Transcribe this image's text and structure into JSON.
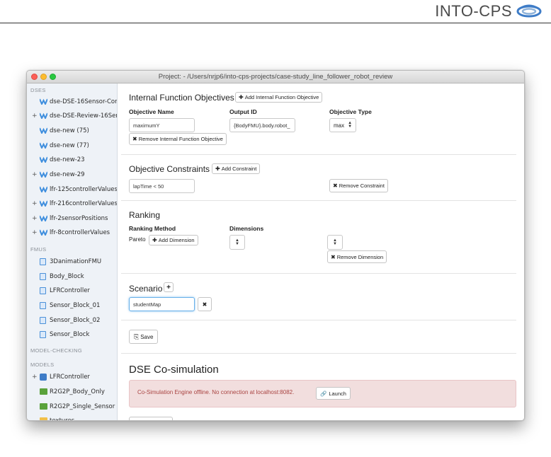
{
  "brand": {
    "name": "INTO-CPS",
    "logo_icon": "into-cps-logo-icon",
    "colors": {
      "primary": "#3e7cc7",
      "accent": "#8fb3da"
    }
  },
  "window": {
    "title": "Project: - /Users/nrjp6/into-cps-projects/case-study_line_follower_robot_review"
  },
  "sidebar": {
    "sections": [
      {
        "header": "DSES",
        "items": [
          {
            "label": "dse-DSE-16Sensor-Conf",
            "expandable": false,
            "icon": "dse-icon"
          },
          {
            "label": "dse-DSE-Review-16Sens",
            "expandable": true,
            "icon": "dse-icon"
          },
          {
            "label": "dse-new (75)",
            "expandable": false,
            "icon": "dse-icon"
          },
          {
            "label": "dse-new (77)",
            "expandable": false,
            "icon": "dse-icon"
          },
          {
            "label": "dse-new-23",
            "expandable": false,
            "icon": "dse-icon"
          },
          {
            "label": "dse-new-29",
            "expandable": true,
            "icon": "dse-icon"
          },
          {
            "label": "lfr-125controllerValues",
            "expandable": false,
            "icon": "dse-icon"
          },
          {
            "label": "lfr-216controllerValues",
            "expandable": true,
            "icon": "dse-icon"
          },
          {
            "label": "lfr-2sensorPositions",
            "expandable": true,
            "icon": "dse-icon"
          },
          {
            "label": "lfr-8controllerValues",
            "expandable": true,
            "icon": "dse-icon"
          }
        ]
      },
      {
        "header": "FMUS",
        "items": [
          {
            "label": "3DanimationFMU",
            "icon": "file-icon"
          },
          {
            "label": "Body_Block",
            "icon": "file-icon"
          },
          {
            "label": "LFRController",
            "icon": "file-icon"
          },
          {
            "label": "Sensor_Block_01",
            "icon": "file-icon"
          },
          {
            "label": "Sensor_Block_02",
            "icon": "file-icon"
          },
          {
            "label": "Sensor_Block",
            "icon": "file-icon"
          }
        ]
      },
      {
        "header": "MODEL-CHECKING",
        "items": []
      },
      {
        "header": "MODELS",
        "items": [
          {
            "label": "LFRController",
            "expandable": true,
            "icon": "fmu-icon"
          },
          {
            "label": "R2G2P_Body_Only",
            "icon": "model-icon"
          },
          {
            "label": "R2G2P_Single_Sensor",
            "icon": "model-icon"
          },
          {
            "label": "textures",
            "icon": "folder-icon"
          }
        ]
      }
    ]
  },
  "internal_objectives": {
    "title": "Internal Function Objectives",
    "add_button": "Add Internal Function Objective",
    "col_name": "Objective Name",
    "col_output": "Output ID",
    "col_type": "Objective Type",
    "name_value": "maximumY",
    "output_value": "{BodyFMU}.body.robot_",
    "type_value": "max",
    "remove_button": "Remove Internal Function Objective"
  },
  "constraints": {
    "title": "Objective Constraints",
    "add_button": "Add Constraint",
    "value": "lapTime < 50",
    "remove_button": "Remove Constraint"
  },
  "ranking": {
    "title": "Ranking",
    "method_label": "Ranking Method",
    "dimensions_label": "Dimensions",
    "method_value": "Pareto",
    "add_dimension_button": "Add Dimension",
    "remove_dimension_button": "Remove Dimension"
  },
  "scenario": {
    "title": "Scenario",
    "value": "studentMap"
  },
  "save_button": "Save",
  "cosim": {
    "title": "DSE Co-simulation",
    "alert_text": "Co-Simulation Engine offline. No connection at localhost:8082.",
    "launch_button": "Launch",
    "alert_color": "#f2dede"
  }
}
